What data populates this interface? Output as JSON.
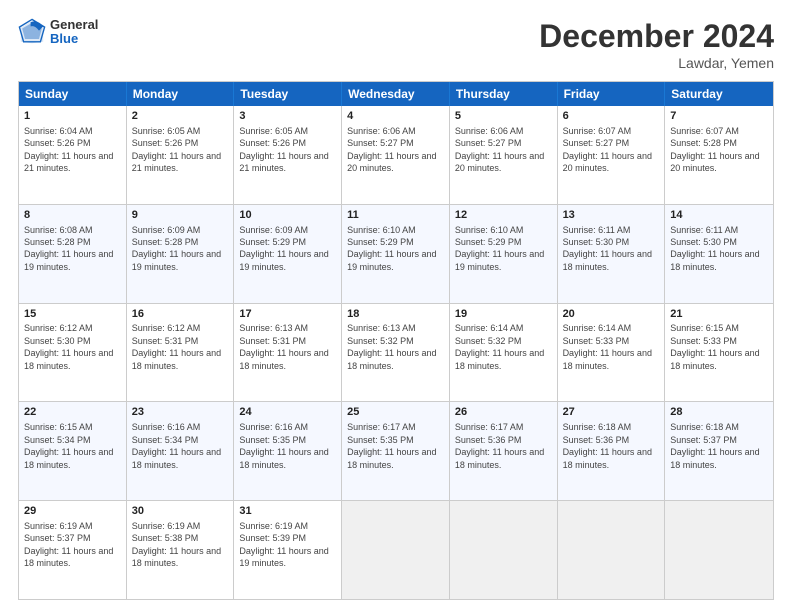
{
  "header": {
    "logo_general": "General",
    "logo_blue": "Blue",
    "month_title": "December 2024",
    "location": "Lawdar, Yemen"
  },
  "days_of_week": [
    "Sunday",
    "Monday",
    "Tuesday",
    "Wednesday",
    "Thursday",
    "Friday",
    "Saturday"
  ],
  "weeks": [
    [
      {
        "day": "1",
        "sunrise": "Sunrise: 6:04 AM",
        "sunset": "Sunset: 5:26 PM",
        "daylight": "Daylight: 11 hours and 21 minutes."
      },
      {
        "day": "2",
        "sunrise": "Sunrise: 6:05 AM",
        "sunset": "Sunset: 5:26 PM",
        "daylight": "Daylight: 11 hours and 21 minutes."
      },
      {
        "day": "3",
        "sunrise": "Sunrise: 6:05 AM",
        "sunset": "Sunset: 5:26 PM",
        "daylight": "Daylight: 11 hours and 21 minutes."
      },
      {
        "day": "4",
        "sunrise": "Sunrise: 6:06 AM",
        "sunset": "Sunset: 5:27 PM",
        "daylight": "Daylight: 11 hours and 20 minutes."
      },
      {
        "day": "5",
        "sunrise": "Sunrise: 6:06 AM",
        "sunset": "Sunset: 5:27 PM",
        "daylight": "Daylight: 11 hours and 20 minutes."
      },
      {
        "day": "6",
        "sunrise": "Sunrise: 6:07 AM",
        "sunset": "Sunset: 5:27 PM",
        "daylight": "Daylight: 11 hours and 20 minutes."
      },
      {
        "day": "7",
        "sunrise": "Sunrise: 6:07 AM",
        "sunset": "Sunset: 5:28 PM",
        "daylight": "Daylight: 11 hours and 20 minutes."
      }
    ],
    [
      {
        "day": "8",
        "sunrise": "Sunrise: 6:08 AM",
        "sunset": "Sunset: 5:28 PM",
        "daylight": "Daylight: 11 hours and 19 minutes."
      },
      {
        "day": "9",
        "sunrise": "Sunrise: 6:09 AM",
        "sunset": "Sunset: 5:28 PM",
        "daylight": "Daylight: 11 hours and 19 minutes."
      },
      {
        "day": "10",
        "sunrise": "Sunrise: 6:09 AM",
        "sunset": "Sunset: 5:29 PM",
        "daylight": "Daylight: 11 hours and 19 minutes."
      },
      {
        "day": "11",
        "sunrise": "Sunrise: 6:10 AM",
        "sunset": "Sunset: 5:29 PM",
        "daylight": "Daylight: 11 hours and 19 minutes."
      },
      {
        "day": "12",
        "sunrise": "Sunrise: 6:10 AM",
        "sunset": "Sunset: 5:29 PM",
        "daylight": "Daylight: 11 hours and 19 minutes."
      },
      {
        "day": "13",
        "sunrise": "Sunrise: 6:11 AM",
        "sunset": "Sunset: 5:30 PM",
        "daylight": "Daylight: 11 hours and 18 minutes."
      },
      {
        "day": "14",
        "sunrise": "Sunrise: 6:11 AM",
        "sunset": "Sunset: 5:30 PM",
        "daylight": "Daylight: 11 hours and 18 minutes."
      }
    ],
    [
      {
        "day": "15",
        "sunrise": "Sunrise: 6:12 AM",
        "sunset": "Sunset: 5:30 PM",
        "daylight": "Daylight: 11 hours and 18 minutes."
      },
      {
        "day": "16",
        "sunrise": "Sunrise: 6:12 AM",
        "sunset": "Sunset: 5:31 PM",
        "daylight": "Daylight: 11 hours and 18 minutes."
      },
      {
        "day": "17",
        "sunrise": "Sunrise: 6:13 AM",
        "sunset": "Sunset: 5:31 PM",
        "daylight": "Daylight: 11 hours and 18 minutes."
      },
      {
        "day": "18",
        "sunrise": "Sunrise: 6:13 AM",
        "sunset": "Sunset: 5:32 PM",
        "daylight": "Daylight: 11 hours and 18 minutes."
      },
      {
        "day": "19",
        "sunrise": "Sunrise: 6:14 AM",
        "sunset": "Sunset: 5:32 PM",
        "daylight": "Daylight: 11 hours and 18 minutes."
      },
      {
        "day": "20",
        "sunrise": "Sunrise: 6:14 AM",
        "sunset": "Sunset: 5:33 PM",
        "daylight": "Daylight: 11 hours and 18 minutes."
      },
      {
        "day": "21",
        "sunrise": "Sunrise: 6:15 AM",
        "sunset": "Sunset: 5:33 PM",
        "daylight": "Daylight: 11 hours and 18 minutes."
      }
    ],
    [
      {
        "day": "22",
        "sunrise": "Sunrise: 6:15 AM",
        "sunset": "Sunset: 5:34 PM",
        "daylight": "Daylight: 11 hours and 18 minutes."
      },
      {
        "day": "23",
        "sunrise": "Sunrise: 6:16 AM",
        "sunset": "Sunset: 5:34 PM",
        "daylight": "Daylight: 11 hours and 18 minutes."
      },
      {
        "day": "24",
        "sunrise": "Sunrise: 6:16 AM",
        "sunset": "Sunset: 5:35 PM",
        "daylight": "Daylight: 11 hours and 18 minutes."
      },
      {
        "day": "25",
        "sunrise": "Sunrise: 6:17 AM",
        "sunset": "Sunset: 5:35 PM",
        "daylight": "Daylight: 11 hours and 18 minutes."
      },
      {
        "day": "26",
        "sunrise": "Sunrise: 6:17 AM",
        "sunset": "Sunset: 5:36 PM",
        "daylight": "Daylight: 11 hours and 18 minutes."
      },
      {
        "day": "27",
        "sunrise": "Sunrise: 6:18 AM",
        "sunset": "Sunset: 5:36 PM",
        "daylight": "Daylight: 11 hours and 18 minutes."
      },
      {
        "day": "28",
        "sunrise": "Sunrise: 6:18 AM",
        "sunset": "Sunset: 5:37 PM",
        "daylight": "Daylight: 11 hours and 18 minutes."
      }
    ],
    [
      {
        "day": "29",
        "sunrise": "Sunrise: 6:19 AM",
        "sunset": "Sunset: 5:37 PM",
        "daylight": "Daylight: 11 hours and 18 minutes."
      },
      {
        "day": "30",
        "sunrise": "Sunrise: 6:19 AM",
        "sunset": "Sunset: 5:38 PM",
        "daylight": "Daylight: 11 hours and 18 minutes."
      },
      {
        "day": "31",
        "sunrise": "Sunrise: 6:19 AM",
        "sunset": "Sunset: 5:39 PM",
        "daylight": "Daylight: 11 hours and 19 minutes."
      },
      null,
      null,
      null,
      null
    ]
  ]
}
